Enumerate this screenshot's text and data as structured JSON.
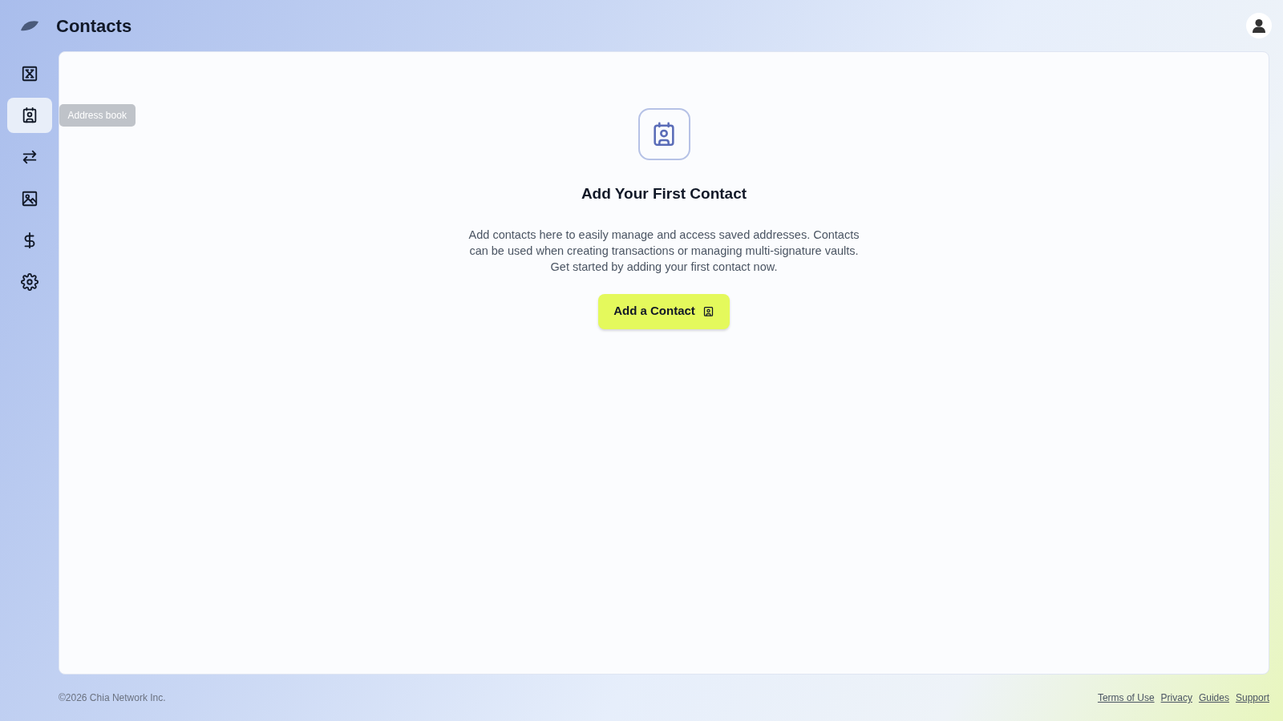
{
  "header": {
    "title": "Contacts"
  },
  "sidebar": {
    "items": [
      {
        "kind": "box",
        "selected": false
      },
      {
        "kind": "contact",
        "selected": true,
        "tooltip": "Address book"
      },
      {
        "kind": "swap",
        "selected": false
      },
      {
        "kind": "image",
        "selected": false
      },
      {
        "kind": "dollar",
        "selected": false
      },
      {
        "kind": "gear",
        "selected": false
      }
    ]
  },
  "empty_state": {
    "title": "Add Your First Contact",
    "description": "Add contacts here to easily manage and access saved addresses. Contacts can be used when creating transactions or managing multi-signature vaults. Get started by adding your first contact now.",
    "button": "Add a Contact"
  },
  "footer": {
    "copyright": "©2026 Chia Network Inc.",
    "links": [
      "Terms of Use",
      "Privacy",
      "Guides",
      "Support"
    ]
  }
}
